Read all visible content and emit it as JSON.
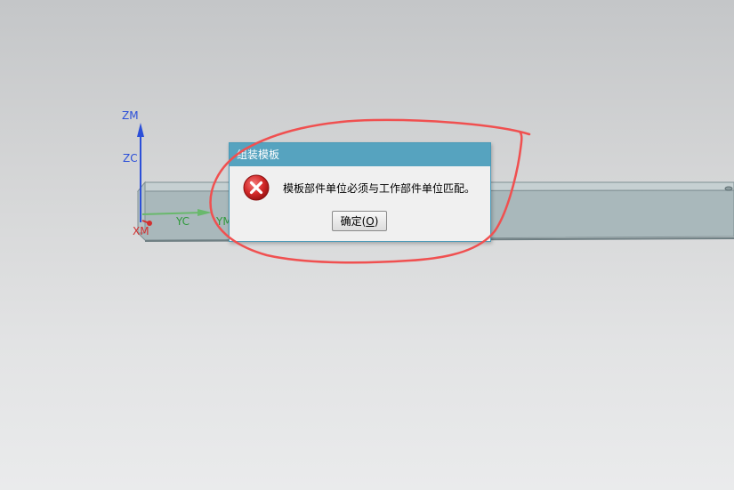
{
  "scene": {
    "axes": {
      "zm": "ZM",
      "zc": "ZC",
      "yc": "YC",
      "ym": "YM",
      "xm": "XM"
    },
    "colors": {
      "z_axis": "#2b4fd8",
      "y_axis": "#2e9a3a",
      "x_axis": "#d23030",
      "beam_face": "#a9b8bb",
      "annotation_stroke": "#f05050"
    }
  },
  "dialog": {
    "title": "组装模板",
    "icon": "error-icon",
    "message": "模板部件单位必须与工作部件单位匹配。",
    "ok_button": {
      "label": "确定(",
      "mnemonic": "O",
      "suffix": ")"
    }
  }
}
